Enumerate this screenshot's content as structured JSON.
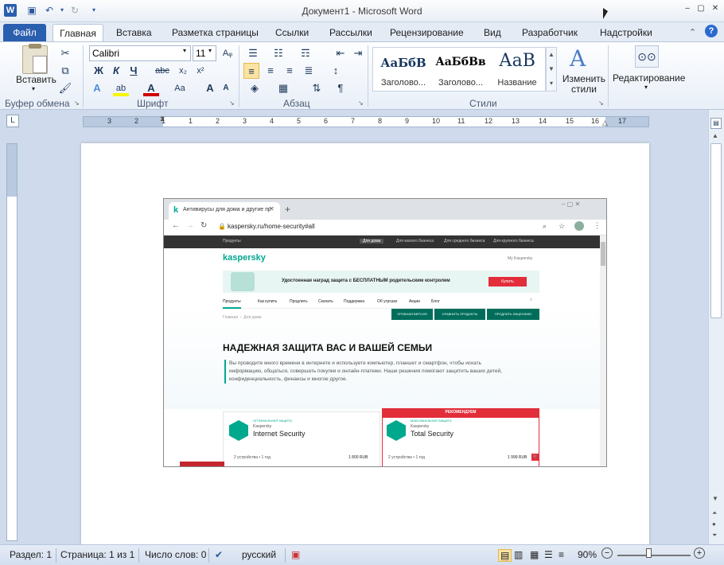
{
  "window": {
    "title": "Документ1 - Microsoft Word"
  },
  "tabs": [
    "Файл",
    "Главная",
    "Вставка",
    "Разметка страницы",
    "Ссылки",
    "Рассылки",
    "Рецензирование",
    "Вид",
    "Разработчик",
    "Надстройки"
  ],
  "ribbon": {
    "clipboard": {
      "paste": "Вставить",
      "label": "Буфер обмена"
    },
    "font": {
      "name": "Calibri",
      "size": "11",
      "label": "Шрифт",
      "bold": "Ж",
      "italic": "К",
      "underline": "Ч",
      "strike": "abc",
      "sub": "x₂",
      "sup": "x²",
      "grow": "A",
      "shrink": "A",
      "case": "Aa"
    },
    "paragraph": {
      "label": "Абзац"
    },
    "styles": {
      "label": "Стили",
      "items": [
        {
          "preview": "АаБбВ",
          "name": "Заголово..."
        },
        {
          "preview": "АаБбВв",
          "name": "Заголово..."
        },
        {
          "preview": "АаВ",
          "name": "Название"
        }
      ],
      "change": "Изменить стили"
    },
    "editing": {
      "label": "Редактирование"
    }
  },
  "ruler": {
    "numbers": [
      "3",
      "2",
      "1",
      "1",
      "2",
      "3",
      "4",
      "5",
      "6",
      "7",
      "8",
      "9",
      "10",
      "11",
      "12",
      "13",
      "14",
      "15",
      "16",
      "17"
    ]
  },
  "embedded": {
    "tab_title": "Антивирусы для дома и другие пр",
    "url": "kaspersky.ru/home-security#all",
    "topnav": [
      "Продукты",
      "Для дома",
      "Для малого бизнеса",
      "Для среднего бизнеса",
      "Для крупного бизнеса"
    ],
    "logo": "kaspersky",
    "my": "My Kaspersky",
    "banner": "Удостоенная наград защита с БЕСПЛАТНЫМ родительским контролем",
    "banner_btn": "Купить",
    "menu": [
      "Продукты",
      "Как купить",
      "Продлить",
      "Скачать",
      "Поддержка",
      "Об угрозах",
      "Акции",
      "Блог"
    ],
    "breadcrumb": [
      "Главная",
      "Для дома"
    ],
    "actions": [
      "ПРОБНАЯ ВЕРСИЯ",
      "СРАВНИТЬ ПРОДУКТЫ",
      "ПРОДЛИТЬ ЛИЦЕНЗИЮ"
    ],
    "headline": "НАДЕЖНАЯ ЗАЩИТА ВАС И ВАШЕЙ СЕМЬИ",
    "body": "Вы проводите много времени в интернете и используете компьютер, планшет и смартфон, чтобы искать информацию, общаться, совершать покупки и онлайн-платежи. Наши решения помогают защитить ваших детей, конфиденциальность, финансы и многое другое.",
    "recommended": "РЕКОМЕНДУЕМ",
    "products": [
      {
        "tag": "ОПТИМАЛЬНАЯ ЗАЩИТА",
        "brand": "Kaspersky",
        "name": "Internet Security",
        "devices": "2 устройства • 1 год",
        "price": "1 800 RUB"
      },
      {
        "tag": "МАКСИМАЛЬНАЯ ЗАЩИТА",
        "brand": "Kaspersky",
        "name": "Total Security",
        "devices": "2 устройства • 1 год",
        "price": "1 999 RUB"
      }
    ]
  },
  "status": {
    "section": "Раздел: 1",
    "page": "Страница: 1 из 1",
    "words": "Число слов: 0",
    "lang": "русский",
    "zoom": "90%"
  }
}
